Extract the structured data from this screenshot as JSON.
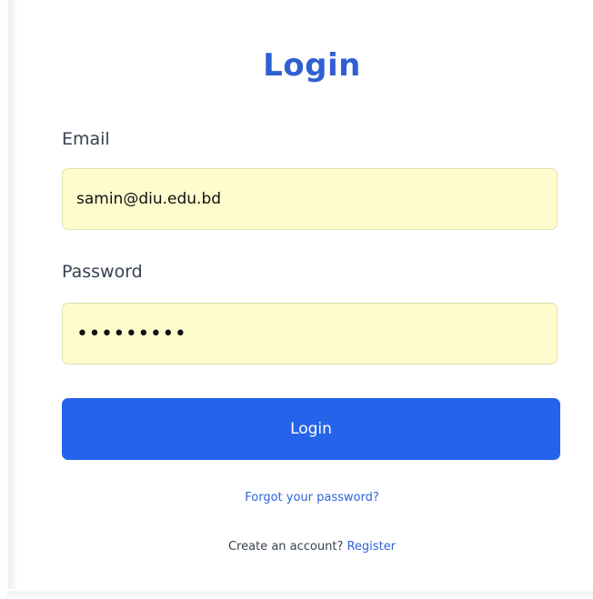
{
  "form": {
    "title": "Login",
    "email_label": "Email",
    "email_value": "samin@diu.edu.bd",
    "password_label": "Password",
    "password_value": "•••••••••",
    "submit_label": "Login"
  },
  "links": {
    "forgot_password": "Forgot your password?",
    "create_account_prompt": "Create an account?",
    "register": "Register"
  },
  "colors": {
    "title": "#2f5fd2",
    "button": "#2563eb",
    "input_background": "#fefbcd",
    "link": "#2f63d8"
  }
}
